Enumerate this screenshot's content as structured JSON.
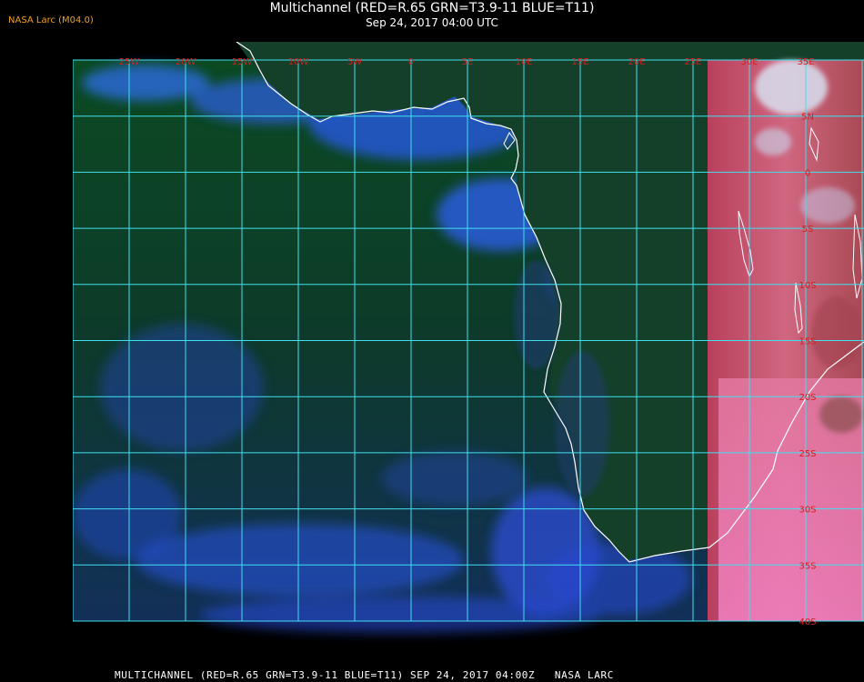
{
  "header": {
    "logo": "NASA Larc (M04.0)",
    "title": "Multichannel (RED=R.65 GRN=T3.9-11 BLUE=T11)",
    "subtitle": "Sep 24, 2017 04:00 UTC"
  },
  "footer": {
    "text": "MULTICHANNEL (RED=R.65 GRN=T3.9-11 BLUE=T11) SEP 24, 2017 04:00Z   NASA LARC"
  },
  "map": {
    "lon_labels": [
      "25W",
      "20W",
      "15W",
      "10W",
      "5W",
      "0",
      "5E",
      "10E",
      "15E",
      "20E",
      "25E",
      "30E",
      "35E"
    ],
    "lat_labels": [
      "5N",
      "0",
      "5S",
      "10S",
      "15S",
      "20S",
      "25S",
      "30S",
      "35S",
      "40S"
    ],
    "colors": {
      "ocean": "#0c3a1c",
      "cloud_blue": "#2a5ef0",
      "land_pink": "#e8708c",
      "grid": "#40e0f0",
      "coast": "#ffffff",
      "label": "#d02020"
    }
  }
}
